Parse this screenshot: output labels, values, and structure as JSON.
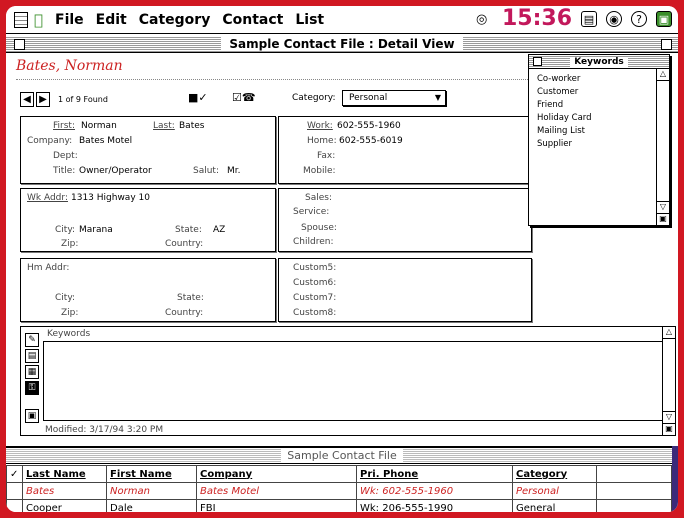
{
  "menubar": {
    "items": [
      "File",
      "Edit",
      "Category",
      "Contact",
      "List"
    ],
    "clock": "15:36",
    "right_icons": [
      "target-icon",
      "battery-icon",
      "globe-icon",
      "help-icon",
      "app-switch-icon"
    ]
  },
  "window": {
    "title": "Sample Contact File : Detail View"
  },
  "detail": {
    "name": "Bates, Norman",
    "found": "1 of 9 Found",
    "category_label": "Category:",
    "category_value": "Personal",
    "first_label": "First:",
    "first": "Norman",
    "last_label": "Last:",
    "last": "Bates",
    "company_label": "Company:",
    "company": "Bates Motel",
    "dept_label": "Dept:",
    "title_label": "Title:",
    "title": "Owner/Operator",
    "salut_label": "Salut:",
    "salut": "Mr.",
    "work_label": "Work:",
    "work": "602-555-1960",
    "home_label": "Home:",
    "home": "602-555-6019",
    "fax_label": "Fax:",
    "mobile_label": "Mobile:",
    "wkaddr_label": "Wk Addr:",
    "wkaddr": "1313 Highway 10",
    "city_label": "City:",
    "city": "Marana",
    "state_label": "State:",
    "state": "AZ",
    "zip_label": "Zip:",
    "country_label": "Country:",
    "sales_label": "Sales:",
    "service_label": "Service:",
    "spouse_label": "Spouse:",
    "children_label": "Children:",
    "hmaddr_label": "Hm Addr:",
    "city2_label": "City:",
    "state2_label": "State:",
    "zip2_label": "Zip:",
    "country2_label": "Country:",
    "custom5": "Custom5:",
    "custom6": "Custom6:",
    "custom7": "Custom7:",
    "custom8": "Custom8:",
    "keywords_label": "Keywords",
    "modified": "Modified: 3/17/94 3:20 PM"
  },
  "keywords_palette": {
    "title": "Keywords",
    "items": [
      "Co-worker",
      "Customer",
      "Friend",
      "Holiday Card",
      "Mailing List",
      "Supplier"
    ]
  },
  "list": {
    "title": "Sample Contact File",
    "columns": [
      "Last Name",
      "First Name",
      "Company",
      "Pri. Phone",
      "Category"
    ],
    "rows": [
      [
        "Bates",
        "Norman",
        "Bates Motel",
        "Wk: 602-555-1960",
        "Personal"
      ],
      [
        "Cooper",
        "Dale",
        "FBI",
        "Wk: 206-555-1990",
        "General"
      ]
    ]
  },
  "colors": {
    "frame": "#d11822",
    "clock": "#c2185b",
    "highlight_text": "#cc2222"
  }
}
